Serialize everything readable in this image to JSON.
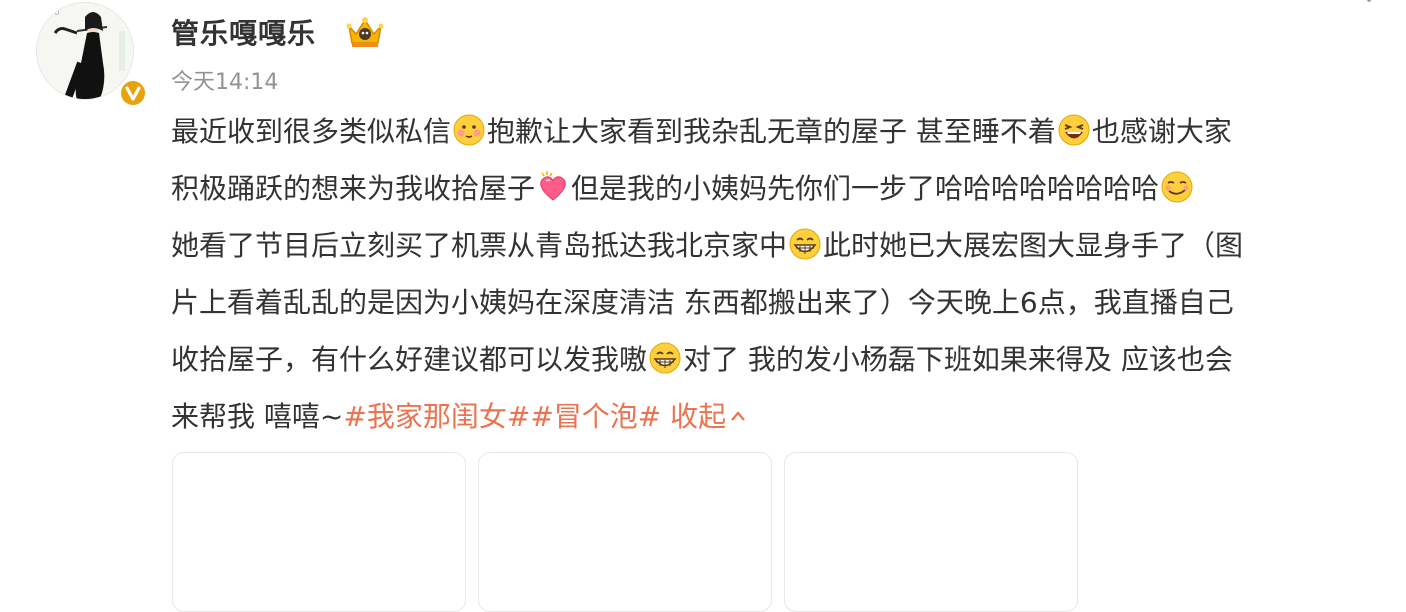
{
  "user": {
    "name": "管乐嘎嘎乐",
    "verified": true,
    "badge_icon": "crown-icon"
  },
  "post": {
    "time": "今天14:14",
    "lines": [
      [
        {
          "t": "text",
          "v": "最近收到很多类似私信"
        },
        {
          "t": "emoji",
          "icon": "blush-emoji"
        },
        {
          "t": "text",
          "v": "抱歉让大家看到我杂乱无章的屋子 甚至睡不着"
        },
        {
          "t": "emoji",
          "icon": "laughing-emoji"
        },
        {
          "t": "text",
          "v": "也感谢大家"
        }
      ],
      [
        {
          "t": "text",
          "v": "积极踊跃的想来为我收拾屋子"
        },
        {
          "t": "emoji",
          "icon": "heart-emoji"
        },
        {
          "t": "text",
          "v": "但是我的小姨妈先你们一步了哈哈哈哈哈哈哈哈"
        },
        {
          "t": "emoji",
          "icon": "smirk-emoji"
        }
      ],
      [
        {
          "t": "text",
          "v": "她看了节目后立刻买了机票从青岛抵达我北京家中"
        },
        {
          "t": "emoji",
          "icon": "grin-emoji"
        },
        {
          "t": "text",
          "v": "此时她已大展宏图大显身手了（图"
        }
      ],
      [
        {
          "t": "text",
          "v": "片上看着乱乱的是因为小姨妈在深度清洁 东西都搬出来了）今天晚上6点，我直播自己"
        }
      ],
      [
        {
          "t": "text",
          "v": "收拾屋子，有什么好建议都可以发我嗷"
        },
        {
          "t": "emoji",
          "icon": "grin-emoji"
        },
        {
          "t": "text",
          "v": "对了 我的发小杨磊下班如果来得及 应该也会"
        }
      ],
      [
        {
          "t": "text",
          "v": "来帮我 嘻嘻~"
        },
        {
          "t": "hashtag",
          "v": "#我家那闺女#"
        },
        {
          "t": "hashtag",
          "v": "#冒个泡#"
        },
        {
          "t": "collapse",
          "v": " 收起"
        }
      ]
    ]
  },
  "colors": {
    "link": "#eb7350",
    "text": "#333333",
    "meta": "#939393",
    "verified": "#e8a20c"
  }
}
